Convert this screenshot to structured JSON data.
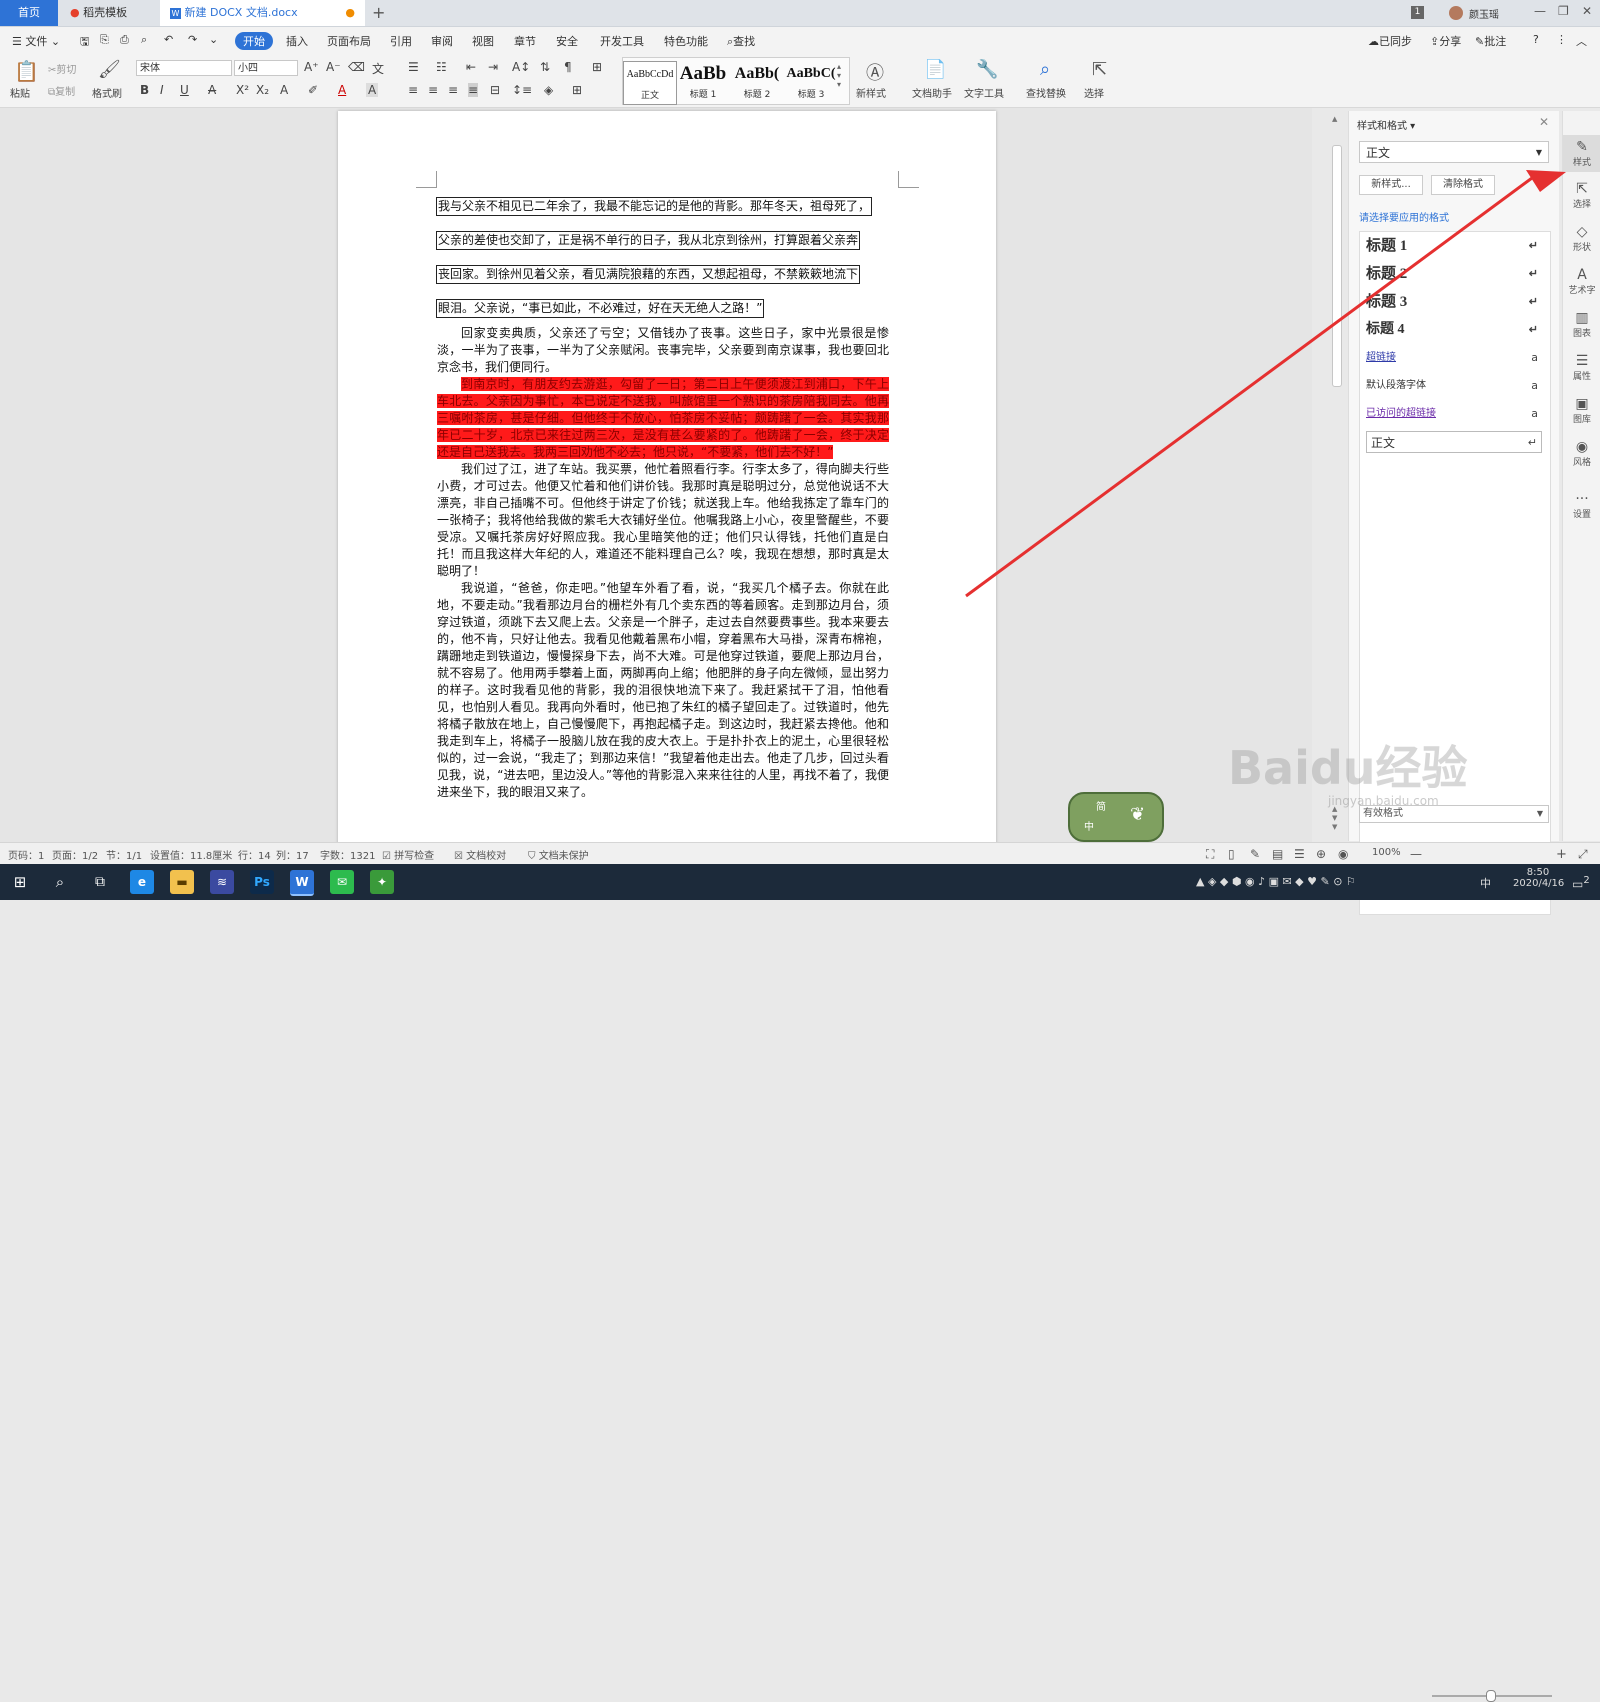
{
  "tabs": {
    "home": "首页",
    "tab1": "稻壳模板",
    "tab2": "新建 DOCX 文档.docx",
    "plus": "+",
    "badge": "1",
    "user": "颜玉瑶"
  },
  "menu": {
    "file": "文件",
    "items": [
      "开始",
      "插入",
      "页面布局",
      "引用",
      "审阅",
      "视图",
      "章节",
      "安全",
      "开发工具",
      "特色功能"
    ],
    "search": "查找",
    "synced": "已同步",
    "share": "分享",
    "annotate": "批注"
  },
  "ribbon": {
    "paste": "粘贴",
    "cut": "剪切",
    "copy": "复制",
    "format_painter": "格式刷",
    "font_name": "宋体",
    "font_size": "小四",
    "styles": [
      {
        "preview": "AaBbCcDd",
        "label": "正文"
      },
      {
        "preview": "AaBb",
        "label": "标题 1"
      },
      {
        "preview": "AaBb(",
        "label": "标题 2"
      },
      {
        "preview": "AaBbC(",
        "label": "标题 3"
      }
    ],
    "new_style": "新样式",
    "doc_helper": "文档助手",
    "text_tools": "文字工具",
    "find_replace": "查找替换",
    "select": "选择"
  },
  "document": {
    "box_lines": [
      "我与父亲不相见已二年余了，我最不能忘记的是他的背影。那年冬天，祖母死了，",
      "父亲的差使也交卸了，正是祸不单行的日子，我从北京到徐州，打算跟着父亲奔",
      "丧回家。到徐州见着父亲，看见满院狼藉的东西，又想起祖母，不禁簌簌地流下",
      "眼泪。父亲说，“事已如此，不必难过，好在天无绝人之路！”"
    ],
    "para1": "回家变卖典质，父亲还了亏空；又借钱办了丧事。这些日子，家中光景很是惨淡，一半为了丧事，一半为了父亲赋闲。丧事完毕，父亲要到南京谋事，我也要回北京念书，我们便同行。",
    "para2": "到南京时，有朋友约去游逛，勾留了一日；第二日上午便须渡江到浦口，下午上车北去。父亲因为事忙，本已说定不送我，叫旅馆里一个熟识的茶房陪我同去。他再三嘱咐茶房，甚是仔细。但他终于不放心，怕茶房不妥帖；颇踌躇了一会。其实我那年已二十岁，北京已来往过两三次，是没有甚么要紧的了。他踌躇了一会，终于决定还是自己送我去。我两三回劝他不必去；他只说，“不要紧，他们去不好！”",
    "para3": "我们过了江，进了车站。我买票，他忙着照看行李。行李太多了，得向脚夫行些小费，才可过去。他便又忙着和他们讲价钱。我那时真是聪明过分，总觉他说话不大漂亮，非自己插嘴不可。但他终于讲定了价钱；就送我上车。他给我拣定了靠车门的一张椅子；我将他给我做的紫毛大衣铺好坐位。他嘱我路上小心，夜里警醒些，不要受凉。又嘱托茶房好好照应我。我心里暗笑他的迂；他们只认得钱，托他们直是白托！而且我这样大年纪的人，难道还不能料理自己么？唉，我现在想想，那时真是太聪明了！",
    "para4": "我说道，“爸爸，你走吧。”他望车外看了看，说，“我买几个橘子去。你就在此地，不要走动。”我看那边月台的栅栏外有几个卖东西的等着顾客。走到那边月台，须穿过铁道，须跳下去又爬上去。父亲是一个胖子，走过去自然要费事些。我本来要去的，他不肯，只好让他去。我看见他戴着黑布小帽，穿着黑布大马褂，深青布棉袍，蹒跚地走到铁道边，慢慢探身下去，尚不大难。可是他穿过铁道，要爬上那边月台，就不容易了。他用两手攀着上面，两脚再向上缩；他肥胖的身子向左微倾，显出努力的样子。这时我看见他的背影，我的泪很快地流下来了。我赶紧拭干了泪，怕他看见，也怕别人看见。我再向外看时，他已抱了朱红的橘子望回走了。过铁道时，他先将橘子散放在地上，自己慢慢爬下，再抱起橘子走。到这边时，我赶紧去搀他。他和我走到车上，将橘子一股脑儿放在我的皮大衣上。于是扑扑衣上的泥土，心里很轻松似的，过一会说，“我走了；到那边来信！”我望着他走出去。他走了几步，回过头看见我，说，“进去吧，里边没人。”等他的背影混入来来往往的人里，再找不着了，我便进来坐下，我的眼泪又来了。"
  },
  "panel": {
    "title": "样式和格式",
    "current": "正文",
    "new_btn": "新样式...",
    "clear_btn": "清除格式",
    "prompt": "请选择要应用的格式",
    "items": [
      {
        "label": "标题 1",
        "mark": "↵"
      },
      {
        "label": "标题 2",
        "mark": "↵"
      },
      {
        "label": "标题 3",
        "mark": "↵"
      },
      {
        "label": "标题 4",
        "mark": "↵"
      },
      {
        "label": "超链接",
        "mark": "a"
      },
      {
        "label": "默认段落字体",
        "mark": "a"
      },
      {
        "label": "已访问的超链接",
        "mark": "a"
      },
      {
        "label": "正文",
        "mark": "↵"
      }
    ],
    "show": "有效格式"
  },
  "right_toolbar": [
    "样式",
    "选择",
    "形状",
    "艺术字",
    "图表",
    "属性",
    "图库",
    "风格",
    "设置"
  ],
  "status": {
    "page": "页码：1",
    "pages": "页面：1/2",
    "section": "节：1/1",
    "setting": "设置值：11.8厘米",
    "row": "行：14",
    "col": "列：17",
    "words": "字数：1321",
    "spell": "拼写检查",
    "proof": "文档校对",
    "protect": "文档未保护",
    "zoom": "100%"
  },
  "taskbar": {
    "time": "8:50",
    "date": "2020/4/16",
    "ime": "中",
    "notify": "2"
  },
  "watermark": {
    "text": "Baidu经验",
    "url": "jingyan.baidu.com"
  },
  "ime_badge": {
    "a": "简",
    "b": "中"
  },
  "colors": {
    "accent": "#2e73d6",
    "highlight": "#ff1a1a",
    "arrow": "#e53030"
  }
}
